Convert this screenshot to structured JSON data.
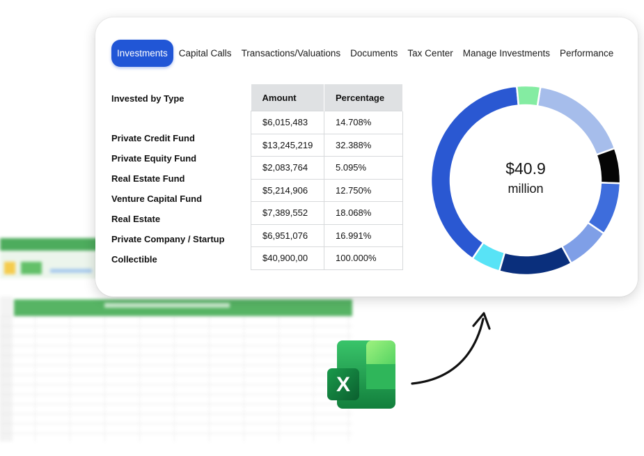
{
  "tabs": [
    {
      "label": "Investments",
      "active": true
    },
    {
      "label": "Capital Calls",
      "active": false
    },
    {
      "label": "Transactions/Valuations",
      "active": false
    },
    {
      "label": "Documents",
      "active": false
    },
    {
      "label": "Tax Center",
      "active": false
    },
    {
      "label": "Manage Investments",
      "active": false
    },
    {
      "label": "Performance",
      "active": false
    }
  ],
  "invested_by_type": {
    "title": "Invested by Type",
    "types": [
      "Private Credit Fund",
      "Private Equity Fund",
      "Real Estate Fund",
      "Venture Capital Fund",
      "Real Estate",
      "Private Company / Startup",
      "Collectible"
    ]
  },
  "table": {
    "headers": {
      "amount": "Amount",
      "percentage": "Percentage"
    },
    "rows": [
      {
        "amount": "$6,015,483",
        "percentage": "14.708%"
      },
      {
        "amount": "$13,245,219",
        "percentage": "32.388%"
      },
      {
        "amount": "$2,083,764",
        "percentage": "5.095%"
      },
      {
        "amount": "$5,214,906",
        "percentage": "12.750%"
      },
      {
        "amount": "$7,389,552",
        "percentage": "18.068%"
      },
      {
        "amount": "$6,951,076",
        "percentage": "16.991%"
      },
      {
        "amount": "$40,900,00",
        "percentage": "100.000%"
      }
    ]
  },
  "donut": {
    "center_value": "$40.9",
    "center_unit": "million",
    "colors": {
      "accent": "#2156d6"
    }
  },
  "chart_data": {
    "type": "pie",
    "style": "donut",
    "center_text": "$40.9 million",
    "slices": [
      {
        "value": 17.0,
        "color": "#a6bdeb"
      },
      {
        "value": 6.0,
        "color": "#050505"
      },
      {
        "value": 9.0,
        "color": "#3e6ddc"
      },
      {
        "value": 7.5,
        "color": "#7f9fe7"
      },
      {
        "value": 12.5,
        "color": "#0a2f7c"
      },
      {
        "value": 5.0,
        "color": "#58e3f6"
      },
      {
        "value": 39.0,
        "color": "#2a58d2"
      },
      {
        "value": 4.0,
        "color": "#84eca2"
      }
    ]
  },
  "excel_icon": {
    "letter": "X"
  }
}
